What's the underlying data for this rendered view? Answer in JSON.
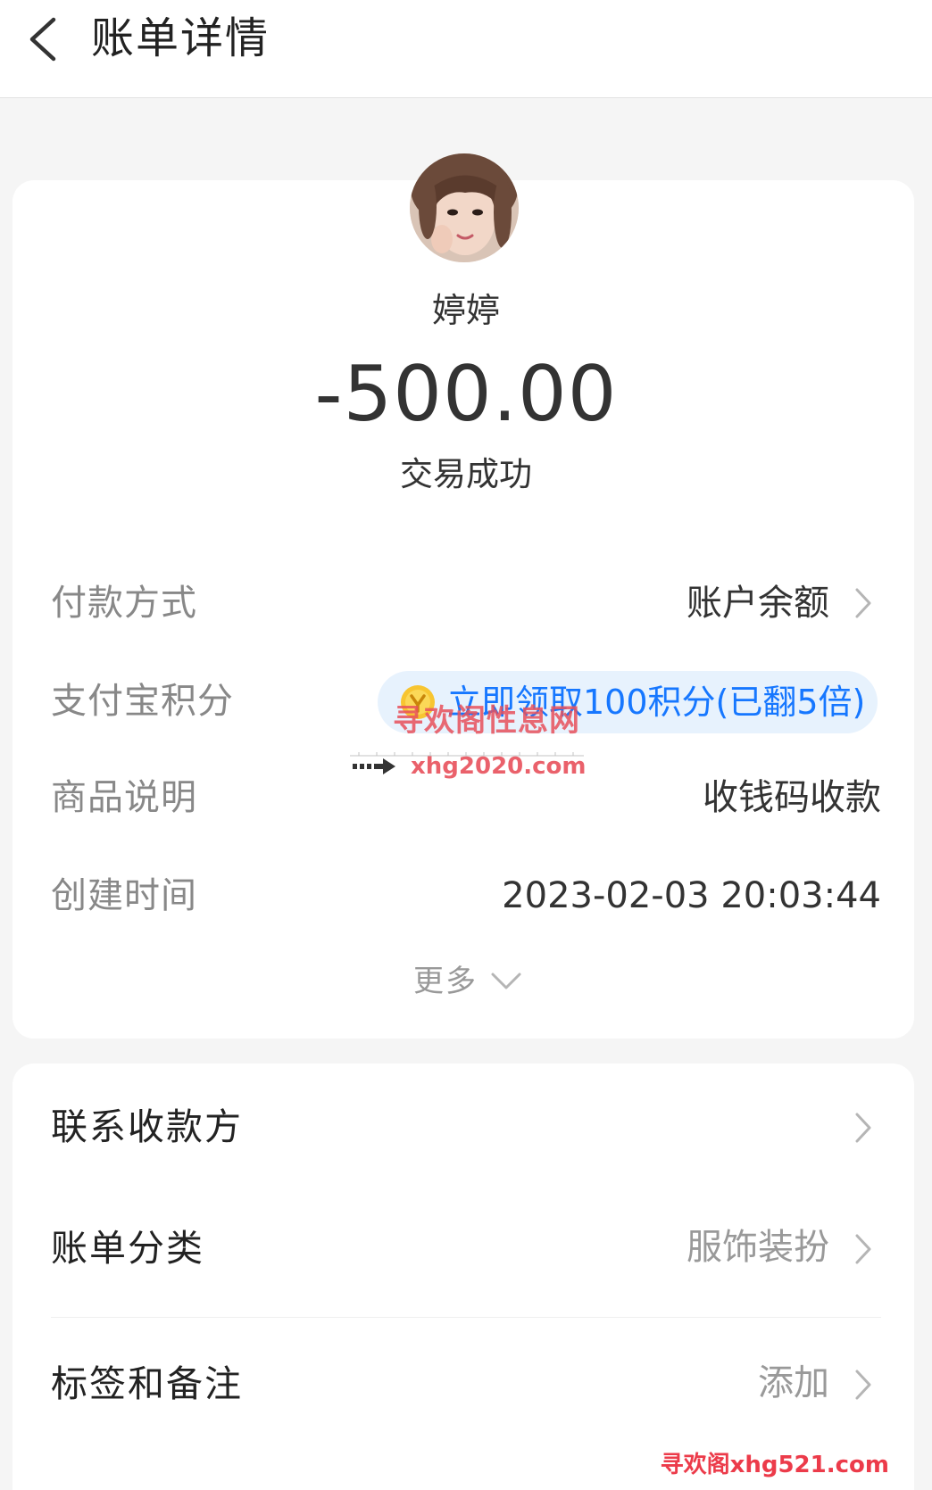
{
  "header": {
    "title": "账单详情"
  },
  "payee": {
    "name": "婷婷",
    "amount": "-500.00",
    "status": "交易成功"
  },
  "details": {
    "payment_method": {
      "label": "付款方式",
      "value": "账户余额"
    },
    "points": {
      "label": "支付宝积分",
      "value": "立即领取100积分(已翻5倍)"
    },
    "product": {
      "label": "商品说明",
      "value": "收钱码收款"
    },
    "created_time": {
      "label": "创建时间",
      "value": "2023-02-03 20:03:44"
    },
    "more_label": "更多"
  },
  "actions": {
    "contact": {
      "label": "联系收款方"
    },
    "category": {
      "label": "账单分类",
      "value": "服饰装扮"
    },
    "tags": {
      "label": "标签和备注",
      "value": "添加"
    }
  },
  "watermarks": {
    "cn": "寻欢阁性息网",
    "url": "xhg2020.com",
    "corner": "寻欢阁xhg521.com"
  },
  "colors": {
    "accent": "#1677ff",
    "pill_bg": "#e7f2fd",
    "watermark": "#e8515c"
  },
  "icons": [
    "back-arrow-icon",
    "chevron-right-icon",
    "chevron-down-icon",
    "coin-icon"
  ]
}
